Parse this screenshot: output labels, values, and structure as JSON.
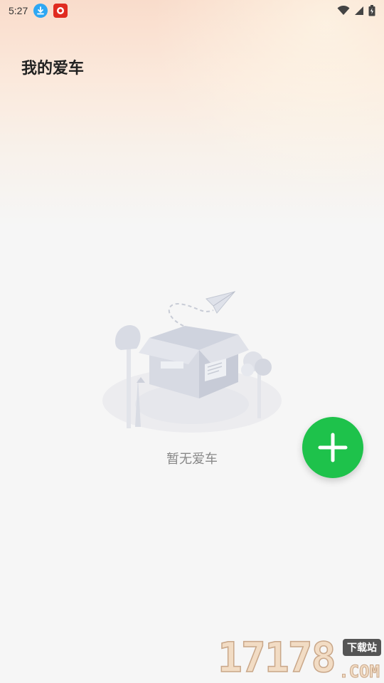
{
  "status_bar": {
    "time": "5:27",
    "left_icons": [
      "download-icon",
      "shop-app-icon"
    ],
    "right_icons": [
      "wifi-icon",
      "signal-icon",
      "battery-icon"
    ]
  },
  "header": {
    "title": "我的爱车"
  },
  "empty_state": {
    "message": "暂无爱车",
    "illustration": "empty-box-illustration"
  },
  "fab": {
    "icon": "plus-icon",
    "color": "#1ec24b"
  },
  "watermark": {
    "digits": "17178",
    "badge": "下载站",
    "suffix": ".COM"
  },
  "colors": {
    "accent": "#1ec24b",
    "header_gradient_top": "#f9dccb",
    "background": "#f6f6f6"
  }
}
